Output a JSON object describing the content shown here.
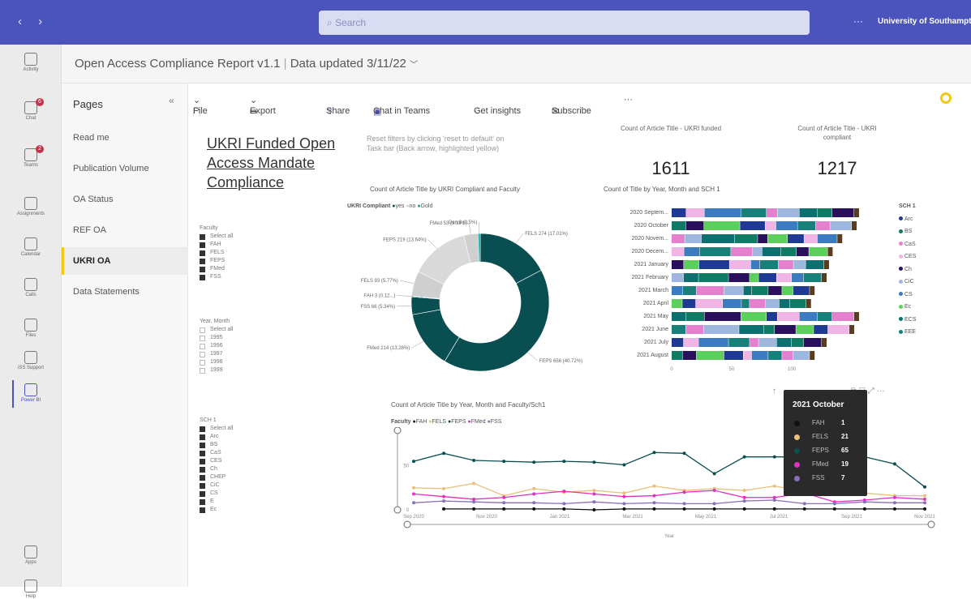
{
  "topbar": {
    "search_placeholder": "Search",
    "org": "University of Southampton",
    "more": "···"
  },
  "rail": [
    {
      "label": "Activity",
      "badge": ""
    },
    {
      "label": "Chat",
      "badge": "6"
    },
    {
      "label": "Teams",
      "badge": "2"
    },
    {
      "label": "Assignments",
      "badge": ""
    },
    {
      "label": "Calendar",
      "badge": ""
    },
    {
      "label": "Calls",
      "badge": ""
    },
    {
      "label": "Files",
      "badge": ""
    },
    {
      "label": "iSS Support",
      "badge": ""
    },
    {
      "label": "Power BI",
      "badge": ""
    },
    {
      "label": "Apps",
      "badge": ""
    },
    {
      "label": "Help",
      "badge": ""
    }
  ],
  "report": {
    "title": "Open Access Compliance Report v1.1",
    "updated": "Data updated 3/11/22"
  },
  "pages": {
    "header": "Pages",
    "items": [
      "Read me",
      "Publication Volume",
      "OA Status",
      "REF OA",
      "UKRI OA",
      "Data Statements"
    ],
    "active": 4
  },
  "toolbar": {
    "file": "File",
    "export": "Export",
    "share": "Share",
    "chat": "Chat in Teams",
    "insights": "Get insights",
    "subscribe": "Subscribe",
    "more": "···"
  },
  "page_title": "UKRI Funded Open Access Mandate Compliance",
  "note": "Reset filters by clicking 'reset to default' on Task bar (Back arrow, highlighted yellow)",
  "kpis": [
    {
      "caption": "Count of Article Title - UKRI funded",
      "value": "1611"
    },
    {
      "caption": "Count of Article Title - UKRI compliant",
      "value": "1217"
    }
  ],
  "slicers": {
    "faculty": {
      "title": "Faculty",
      "items": [
        "Select all",
        "FAH",
        "FELS",
        "FEPS",
        "FMed",
        "FSS"
      ]
    },
    "year_month": {
      "title": "Year, Month",
      "items": [
        "Select all",
        "1995",
        "1996",
        "1997",
        "1998",
        "1999"
      ]
    },
    "sch": {
      "title": "SCH 1",
      "items": [
        "Select all",
        "Arc",
        "BS",
        "CaS",
        "CES",
        "Ch",
        "CHEP",
        "CiC",
        "CS",
        "E",
        "Ec"
      ]
    }
  },
  "tooltip": {
    "title": "2021 October",
    "rows": [
      {
        "name": "FAH",
        "value": "1",
        "color": "#111111"
      },
      {
        "name": "FELS",
        "value": "21",
        "color": "#e8c07a"
      },
      {
        "name": "FEPS",
        "value": "65",
        "color": "#094f52"
      },
      {
        "name": "FMed",
        "value": "19",
        "color": "#e52fc4"
      },
      {
        "name": "FSS",
        "value": "7",
        "color": "#8a6fb9"
      }
    ]
  },
  "colors": {
    "accent": "#4b53bc",
    "active_page": "#f2c811",
    "donut_yes": "#094f52",
    "donut_no": "#d0d0d0"
  },
  "chart_data": [
    {
      "type": "pie",
      "title": "Count of Article Title by UKRI Compliant and Faculty",
      "legend_title": "UKRI Compliant",
      "legend": [
        {
          "name": "yes",
          "color": "#094f52"
        },
        {
          "name": "no",
          "color": "#d0d0d0"
        },
        {
          "name": "Gold",
          "color": "#0fa39a"
        }
      ],
      "slices": [
        {
          "label": "FELS 274 (17.01%)",
          "value": 274,
          "color": "#094f52"
        },
        {
          "label": "FEPS 656 (40.72%)",
          "value": 656,
          "color": "#094f52"
        },
        {
          "label": "FMed 214 (13.28%)",
          "value": 214,
          "color": "#094f52"
        },
        {
          "label": "FSS 66 (5.34%)",
          "value": 66,
          "color": "#094f52"
        },
        {
          "label": "FAH 3 (0.12...)",
          "value": 3,
          "color": "#094f52"
        },
        {
          "label": "FELS 93 (5.77%)",
          "value": 93,
          "color": "#cfcfcf"
        },
        {
          "label": "FEPS 219 (13.64%)",
          "value": 219,
          "color": "#d9d9d9"
        },
        {
          "label": "FMed 53 (3.33%)",
          "value": 53,
          "color": "#cfcfcf"
        },
        {
          "label": "Gen 8 (0.5%)",
          "value": 8,
          "color": "#0fa39a"
        }
      ]
    },
    {
      "type": "bar",
      "stacked": true,
      "orientation": "horizontal",
      "title": "Count of Title by Year, Month and SCH 1",
      "categories": [
        "2020 Septem...",
        "2020 October",
        "2020 Novem...",
        "2020 Decem...",
        "2021 January",
        "2021 February",
        "2021 March",
        "2021 April",
        "2021 May",
        "2021 June",
        "2021 July",
        "2021 August"
      ],
      "legend_title": "SCH 1",
      "legend": [
        {
          "name": "Arc",
          "color": "#1f3a93"
        },
        {
          "name": "BS",
          "color": "#117a65"
        },
        {
          "name": "CaS",
          "color": "#e57fd0"
        },
        {
          "name": "CES",
          "color": "#f0b4e6"
        },
        {
          "name": "Ch",
          "color": "#2a0f5c"
        },
        {
          "name": "CiC",
          "color": "#9db7e0"
        },
        {
          "name": "CS",
          "color": "#3b7bbf"
        },
        {
          "name": "Ec",
          "color": "#5bd15b"
        },
        {
          "name": "ECS",
          "color": "#0e6f70"
        },
        {
          "name": "EEE",
          "color": "#17807a"
        }
      ],
      "x_ticks": [
        "0",
        "50",
        "100"
      ],
      "totals": [
        152,
        150,
        138,
        130,
        127,
        125,
        115,
        112,
        152,
        148,
        125,
        115
      ]
    },
    {
      "type": "line",
      "title": "Count of Article Title by Year, Month and Faculty/Sch1",
      "xlabel": "Year",
      "legend_title": "Faculty",
      "x_ticks": [
        "Sep 2020",
        "Nov 2020",
        "Jan 2021",
        "Mar 2021",
        "May 2021",
        "Jul 2021",
        "Sep 2021",
        "Nov 2021"
      ],
      "y_ticks": [
        "0",
        "50"
      ],
      "ylim": [
        0,
        90
      ],
      "series": [
        {
          "name": "FAH",
          "color": "#111111",
          "values": [
            null,
            1,
            1,
            1,
            1,
            1,
            0,
            1,
            1,
            1,
            1,
            1,
            1,
            1,
            1,
            1,
            1,
            1
          ]
        },
        {
          "name": "FELS",
          "color": "#e8c07a",
          "values": [
            25,
            24,
            30,
            16,
            24,
            20,
            22,
            19,
            27,
            22,
            24,
            22,
            27,
            21,
            21,
            19,
            16,
            16
          ]
        },
        {
          "name": "FEPS",
          "color": "#094f52",
          "values": [
            55,
            64,
            56,
            55,
            54,
            55,
            54,
            51,
            65,
            64,
            41,
            60,
            60,
            60,
            65,
            60,
            52,
            26
          ]
        },
        {
          "name": "FMed",
          "color": "#e52fc4",
          "values": [
            18,
            15,
            12,
            14,
            18,
            21,
            18,
            15,
            16,
            20,
            22,
            14,
            14,
            19,
            9,
            11,
            14,
            12
          ]
        },
        {
          "name": "FSS",
          "color": "#8a6fb9",
          "values": [
            8,
            10,
            9,
            8,
            8,
            7,
            9,
            7,
            8,
            7,
            7,
            10,
            11,
            7,
            7,
            9,
            8,
            8
          ]
        }
      ]
    }
  ]
}
